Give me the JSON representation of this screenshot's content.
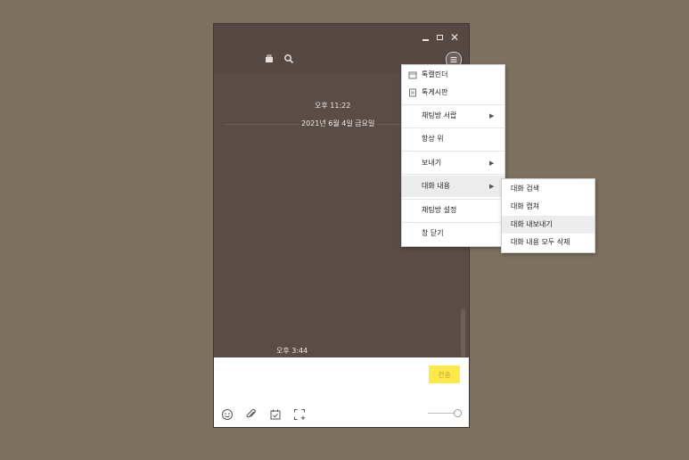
{
  "window": {
    "controls": {
      "minimize_icon": "minimize-icon",
      "maximize_icon": "maximize-icon",
      "close_glyph": "✕"
    },
    "toolbar": {
      "icons": [
        "drawer-icon",
        "search-icon",
        "menu-icon"
      ]
    }
  },
  "chat": {
    "time_top": "오후 11:22",
    "date_divider": "2021년 6월 4일 금요일",
    "time_bottom": "오후 3:44"
  },
  "input": {
    "send_label": "전송",
    "bottom_icons": [
      "emoji-icon",
      "attach-icon",
      "schedule-icon",
      "capture-icon"
    ],
    "volume_level": 1.0
  },
  "menu": {
    "items": [
      {
        "label": "톡캘린더",
        "icon": "calendar-icon"
      },
      {
        "label": "톡게시판",
        "icon": "board-icon"
      },
      {
        "label": "채팅방 서랍",
        "arrow": "▶"
      },
      {
        "label": "항상 위"
      },
      {
        "label": "보내기",
        "arrow": "▶"
      },
      {
        "label": "대화 내용",
        "arrow": "▶",
        "highlighted": true
      },
      {
        "label": "채팅방 설정"
      },
      {
        "label": "창 닫기"
      }
    ]
  },
  "submenu": {
    "items": [
      {
        "label": "대화 검색"
      },
      {
        "label": "대화 캡쳐"
      },
      {
        "label": "대화 내보내기",
        "highlighted": true
      },
      {
        "label": "대화 내용 모두 삭제"
      }
    ]
  },
  "colors": {
    "desktop": "#7b715e",
    "chat_background": "#5a4c47",
    "send_button": "#fde94a"
  }
}
